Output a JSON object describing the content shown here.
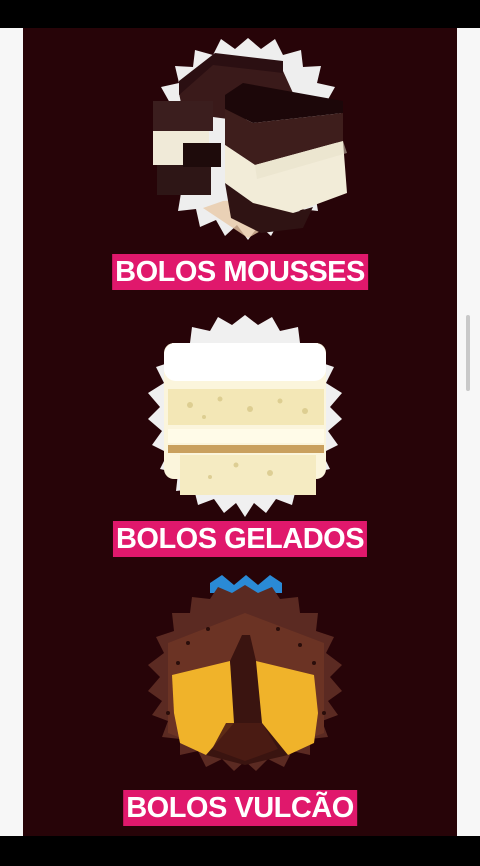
{
  "products": [
    {
      "label": "BOLOS MOUSSES",
      "image": "chocolate-mousse-cake-slice"
    },
    {
      "label": "BOLOS GELADOS",
      "image": "coconut-iced-cake-slice"
    },
    {
      "label": "BOLOS VULCÃO",
      "image": "chocolate-volcano-cake"
    }
  ],
  "colors": {
    "page_background": "#270408",
    "label_background": "#e0186c",
    "label_text": "#ffffff"
  }
}
